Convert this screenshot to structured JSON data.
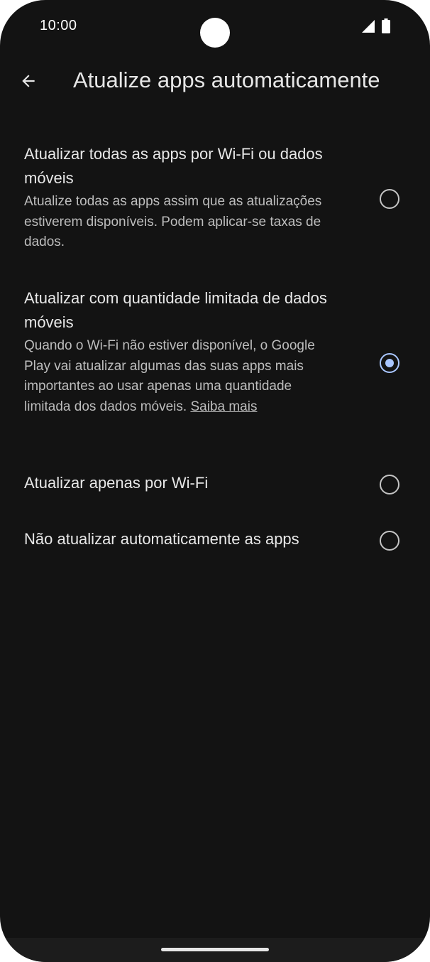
{
  "status_bar": {
    "time": "10:00",
    "signal_icon": "cellular-signal-icon",
    "battery_icon": "battery-icon"
  },
  "app_bar": {
    "back_icon": "arrow-back-icon",
    "title": "Atualize apps automaticamente"
  },
  "options": [
    {
      "title": "Atualizar todas as apps por Wi-Fi ou dados móveis",
      "description": "Atualize todas as apps assim que as atualizações estiverem disponíveis. Podem aplicar-se taxas de dados.",
      "selected": false
    },
    {
      "title": "Atualizar com quantidade limitada de dados móveis",
      "description": "Quando o Wi-Fi não estiver disponível, o Google Play vai atualizar algumas das suas apps mais importantes ao usar apenas uma quantidade limitada dos dados móveis.",
      "link": "Saiba mais",
      "selected": true
    },
    {
      "title": "Atualizar apenas por Wi-Fi",
      "selected": false
    },
    {
      "title": "Não atualizar automaticamente as apps",
      "selected": false
    }
  ],
  "colors": {
    "background": "#131313",
    "accent": "#a9c6ff",
    "text_primary": "#e8e8e8",
    "text_secondary": "#bdbdbd"
  }
}
